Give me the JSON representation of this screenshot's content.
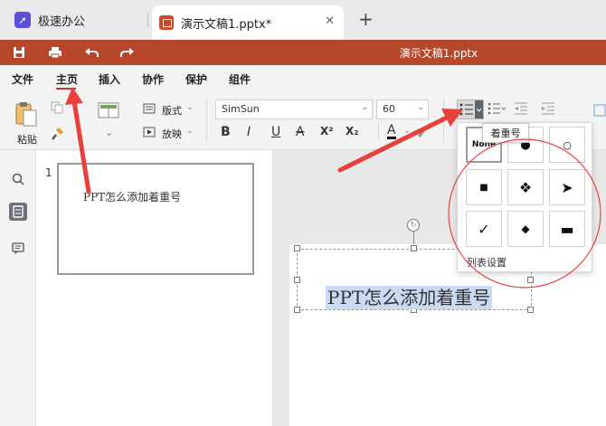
{
  "tabs": {
    "app_name": "极速办公",
    "doc_tab": "演示文稿1.pptx*",
    "close": "✕",
    "new_tab": "+"
  },
  "titlebar": {
    "title": "演示文稿1.pptx"
  },
  "menu": {
    "items": [
      "文件",
      "主页",
      "插入",
      "协作",
      "保护",
      "组件"
    ],
    "active": "主页"
  },
  "ribbon": {
    "paste_label": "粘贴",
    "layout_label": "版式",
    "play_label": "放映",
    "font_name": "SimSun",
    "font_size": "60",
    "bold": "B",
    "italic": "I",
    "underline": "U",
    "strikethrough": "A",
    "superscript": "X²",
    "subscript": "X₂",
    "font_color": "A"
  },
  "slides_panel": {
    "slide_number": "1",
    "thumb_text": "PPT怎么添加着重号"
  },
  "canvas": {
    "slide_text": "PPT怎么添加着重号"
  },
  "bullet_menu": {
    "tooltip": "着重号",
    "none_label": "None",
    "list_settings": "列表设置",
    "bullets": [
      "●",
      "○",
      "■",
      "❖",
      "➤",
      "✓",
      "◆",
      "▬"
    ]
  },
  "colors": {
    "titlebar": "#b7472a",
    "accent_red": "#e8413b",
    "selection": "#c9daf2"
  }
}
